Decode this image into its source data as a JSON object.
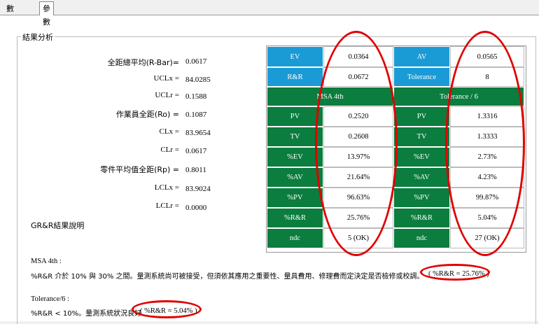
{
  "tabs": [
    "數據輸入",
    "參數"
  ],
  "section_title": "結果分析",
  "stats": [
    {
      "label": "全距總平均(R-Bar)=",
      "value": "0.0617"
    },
    {
      "label": "UCLx =",
      "value": "84.0285"
    },
    {
      "label": "UCLr =",
      "value": "0.1588"
    },
    {
      "label": "作業員全距(Ro) =",
      "value": "0.1087"
    },
    {
      "label": "CLx =",
      "value": "83.9654"
    },
    {
      "label": "CLr =",
      "value": "0.0617"
    },
    {
      "label": "零件平均值全距(Rp) =",
      "value": "0.8011"
    },
    {
      "label": "LCLx =",
      "value": "83.9024"
    },
    {
      "label": "LCLr =",
      "value": "0.0000"
    }
  ],
  "grr_title": "GR&R結果說明",
  "table": {
    "top": [
      {
        "k1": "EV",
        "v1": "0.0364",
        "k2": "AV",
        "v2": "0.0565"
      },
      {
        "k1": "R&R",
        "v1": "0.0672",
        "k2": "Tolerance",
        "v2": "8"
      }
    ],
    "header_left": "MSA 4th",
    "header_right": "Tolerance / 6",
    "rows": [
      {
        "label": "PV",
        "msa": "0.2520",
        "tol": "1.3316"
      },
      {
        "label": "TV",
        "msa": "0.2608",
        "tol": "1.3333"
      },
      {
        "label": "%EV",
        "msa": "13.97%",
        "tol": "2.73%"
      },
      {
        "label": "%AV",
        "msa": "21.64%",
        "tol": "4.23%"
      },
      {
        "label": "%PV",
        "msa": "96.63%",
        "tol": "99.87%"
      },
      {
        "label": "%R&R",
        "msa": "25.76%",
        "tol": "5.04%"
      },
      {
        "label": "ndc",
        "msa": "5 (OK)",
        "tol": "27 (OK)"
      }
    ]
  },
  "explanations": {
    "msa_title": "MSA 4th :",
    "msa_text": "%R&R 介於 10% 與 30% 之間。量測系統尚可被接受，但須依其應用之重要性、量具費用、修理費而定決定是否檢修或校調。",
    "msa_result": "( %R&R = 25.76% )",
    "tol_title": "Tolerance/6 :",
    "tol_text": "%R&R < 10%。量測系統狀況良好",
    "tol_result": "( %R&R = 5.04% )"
  },
  "colors": {
    "blue": "#1a9bd6",
    "green": "#0b7d3e",
    "annotation": "#e00000"
  }
}
